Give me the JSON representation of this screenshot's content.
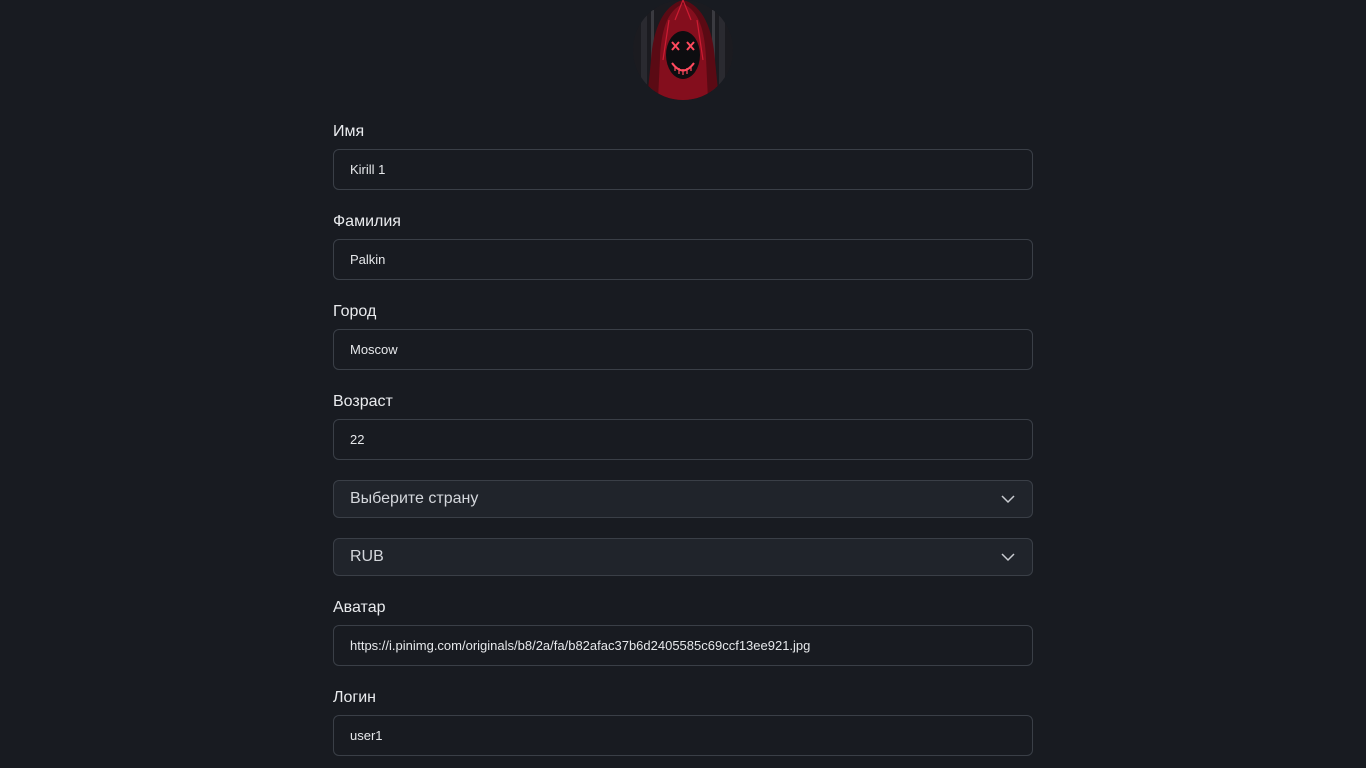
{
  "profile": {
    "avatar_icon": "hooded-figure-avatar"
  },
  "fields": {
    "first_name": {
      "label": "Имя",
      "value": "Kirill 1"
    },
    "last_name": {
      "label": "Фамилия",
      "value": "Palkin"
    },
    "city": {
      "label": "Город",
      "value": "Moscow"
    },
    "age": {
      "label": "Возраст",
      "value": "22"
    },
    "country": {
      "selected": "Выберите страну"
    },
    "currency": {
      "selected": "RUB"
    },
    "avatar_url": {
      "label": "Аватар",
      "value": "https://i.pinimg.com/originals/b8/2a/fa/b82afac37b6d2405585c69ccf13ee921.jpg"
    },
    "login": {
      "label": "Логин",
      "value": "user1"
    }
  },
  "colors": {
    "background": "#181b21",
    "border": "#3a3f47",
    "select_bg": "#20242b",
    "avatar_accent": "#c0152a"
  }
}
